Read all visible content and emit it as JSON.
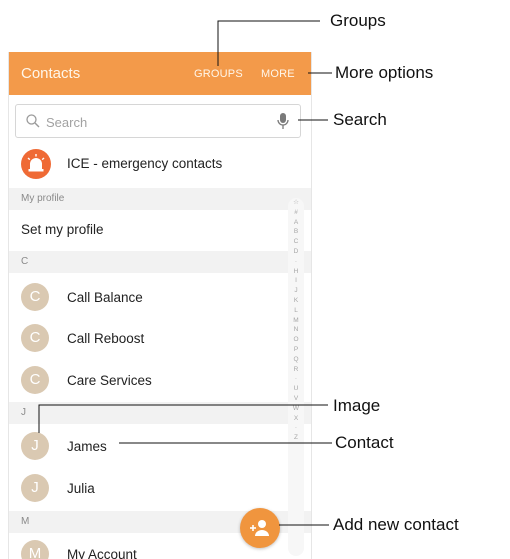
{
  "appbar": {
    "title": "Contacts",
    "groups_label": "GROUPS",
    "more_label": "MORE"
  },
  "search": {
    "placeholder": "Search"
  },
  "ice": {
    "label": "ICE - emergency contacts"
  },
  "sections": {
    "my_profile": "My profile",
    "c": "C",
    "j": "J",
    "m": "M"
  },
  "profile": {
    "label": "Set my profile"
  },
  "contacts": [
    {
      "initial": "C",
      "name": "Call Balance"
    },
    {
      "initial": "C",
      "name": "Call Reboost"
    },
    {
      "initial": "C",
      "name": "Care Services"
    },
    {
      "initial": "J",
      "name": "James"
    },
    {
      "initial": "J",
      "name": "Julia"
    },
    {
      "initial": "M",
      "name": "My Account"
    }
  ],
  "index_letters": [
    "☆",
    "#",
    "A",
    "B",
    "C",
    "D",
    "·",
    "H",
    "I",
    "J",
    "K",
    "L",
    "M",
    "N",
    "O",
    "P",
    "Q",
    "R",
    "·",
    "U",
    "V",
    "W",
    "X",
    "·",
    "Z"
  ],
  "callouts": {
    "groups": "Groups",
    "more_options": "More options",
    "search": "Search",
    "image": "Image",
    "contact": "Contact",
    "add_new_contact": "Add new contact"
  },
  "colors": {
    "accent": "#f39a4a",
    "avatar": "#dac9b2",
    "ice_badge": "#ef6a35"
  },
  "icons": {
    "search": "search-icon",
    "mic": "microphone-icon",
    "ice": "siren-icon",
    "add_contact": "add-contact-icon"
  }
}
